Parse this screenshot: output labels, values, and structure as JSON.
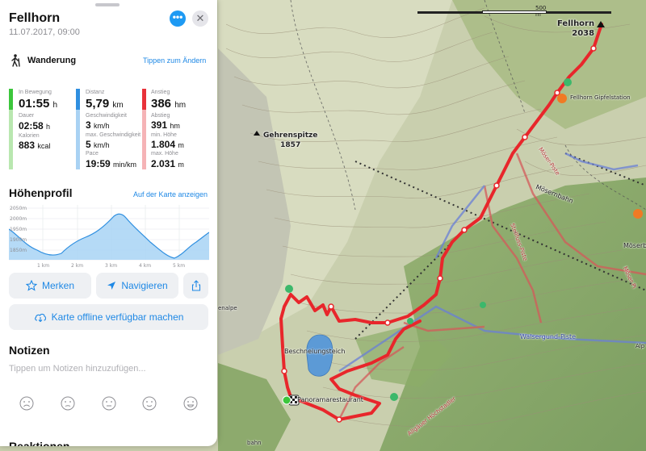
{
  "tour": {
    "title": "Fellhorn",
    "date": "11.07.2017, 09:00",
    "activity": "Wanderung",
    "change_tip": "Tippen zum Ändern",
    "more_icon": "ellipsis-icon",
    "close_icon": "close-icon"
  },
  "stats": {
    "col1": {
      "color": "#3cc63c",
      "in_motion_label": "In Bewegung",
      "in_motion_value": "01:55",
      "in_motion_unit": "h",
      "duration_label": "Dauer",
      "duration_value": "02:58",
      "duration_unit": "h",
      "calories_label": "Kalorien",
      "calories_value": "883",
      "calories_unit": "kcal"
    },
    "col2": {
      "color": "#2f8fe0",
      "distance_label": "Distanz",
      "distance_value": "5,79",
      "distance_unit": "km",
      "speed_label": "Geschwindigkeit",
      "speed_value": "3",
      "speed_unit": "km/h",
      "max_speed_label": "max. Geschwindigkeit",
      "max_speed_value": "5",
      "max_speed_unit": "km/h",
      "pace_label": "Pace",
      "pace_value": "19:59",
      "pace_unit": "min/km"
    },
    "col3": {
      "color": "#e8323a",
      "ascent_label": "Anstieg",
      "ascent_value": "386",
      "ascent_unit": "hm",
      "descent_label": "Abstieg",
      "descent_value": "391",
      "descent_unit": "hm",
      "min_height_label": "min. Höhe",
      "min_height_value": "1.804",
      "min_height_unit": "m",
      "max_height_label": "max. Höhe",
      "max_height_value": "2.031",
      "max_height_unit": "m"
    }
  },
  "profile": {
    "title": "Höhenprofil",
    "map_link": "Auf der Karte anzeigen",
    "y_ticks": [
      "2050m",
      "2000m",
      "1950m",
      "1900m",
      "1850m"
    ],
    "x_ticks": [
      "1 km",
      "2 km",
      "3 km",
      "4 km",
      "5 km"
    ]
  },
  "actions": {
    "bookmark_label": "Merken",
    "bookmark_icon": "star-icon",
    "navigate_label": "Navigieren",
    "navigate_icon": "location-arrow-icon",
    "share_icon": "share-icon",
    "offline_label": "Karte offline verfügbar machen",
    "offline_icon": "cloud-download-icon"
  },
  "notes": {
    "title": "Notizen",
    "placeholder": "Tippen um Notizen hinzuzufügen..."
  },
  "reactions": {
    "title": "Reaktionen"
  },
  "map": {
    "scale_label": "500 m",
    "peak_fellhorn_name": "Fellhorn",
    "peak_fellhorn_elev": "2038",
    "peak_gehren_name": "Gehrenspitze",
    "peak_gehren_elev": "1857",
    "lake": "Beschneiungsteich",
    "restaurant": "Panoramarestaurant",
    "summit_station": "Fellhorn Gipfelstation",
    "lift": "Mösernbahn",
    "lift_2": "Möserb",
    "piste_1": "Möser-Piste",
    "piste_2": "Stellfuss-Piste",
    "piste_3": "Walsergund-Piste",
    "piste_4": "Allgäuer Höchstadler",
    "piste_5": "Möser-Pi",
    "alpe_left": "enalpe",
    "bahn_bottom": "bahn",
    "alp_right": "Alp",
    "route_color": "#e8262b"
  }
}
